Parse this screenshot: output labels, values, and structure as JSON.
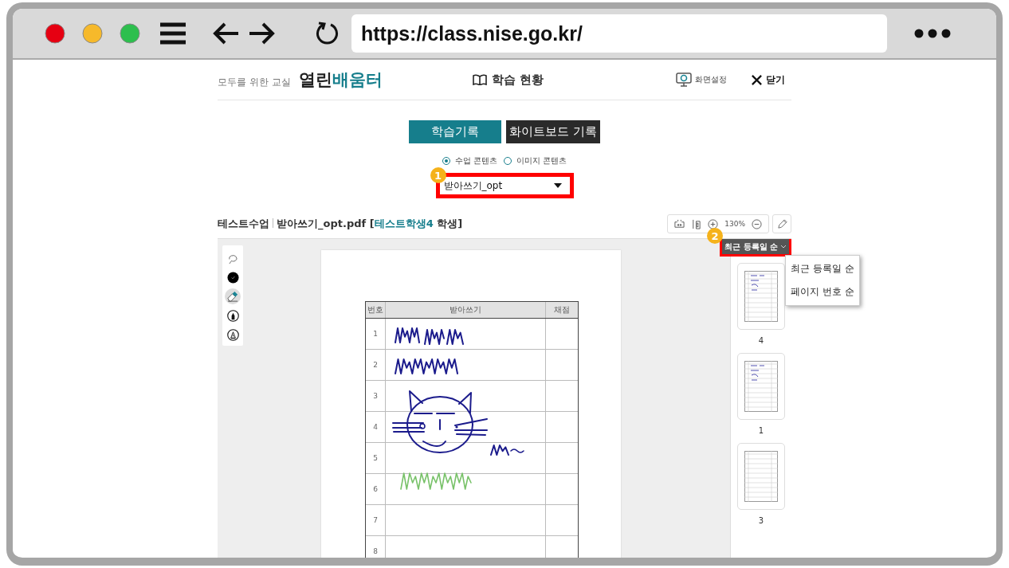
{
  "browser": {
    "url": "https://class.nise.go.kr/"
  },
  "header": {
    "tagline": "모두를 위한 교실",
    "brand": [
      "열린",
      "배움터"
    ],
    "title": "학습 현황",
    "settings": "화면설정",
    "close": "닫기"
  },
  "tabs": [
    {
      "label": "학습기록",
      "selected": true
    },
    {
      "label": "화이트보드 기록",
      "selected": false
    }
  ],
  "content_types": [
    {
      "label": "수업 콘텐츠",
      "selected": true
    },
    {
      "label": "이미지 콘텐츠",
      "selected": false
    }
  ],
  "content_select": {
    "value": "받아쓰기_opt",
    "callout": "1"
  },
  "document": {
    "course": "테스트수업",
    "file": "받아쓰기_opt.pdf [",
    "student": "테스트학생4",
    "suffix": " 학생]",
    "zoom": "130%"
  },
  "tools": [
    {
      "kind": "lasso",
      "selected": false
    },
    {
      "kind": "color",
      "selected": false
    },
    {
      "kind": "eraser",
      "selected": true
    },
    {
      "kind": "marker",
      "selected": false
    },
    {
      "kind": "pen",
      "selected": false
    }
  ],
  "sheet": {
    "columns": [
      "번호",
      "받아쓰기",
      "채점"
    ],
    "rows": [
      "1",
      "2",
      "3",
      "4",
      "5",
      "6",
      "7",
      "8"
    ]
  },
  "sort": {
    "label": "최근 등록일 순",
    "callout": "2",
    "options": [
      "최근 등록일 순",
      "페이지 번호 순"
    ]
  },
  "thumbnails": [
    {
      "label": "4",
      "inked": true
    },
    {
      "label": "1",
      "inked": true
    },
    {
      "label": "3",
      "inked": false
    }
  ]
}
